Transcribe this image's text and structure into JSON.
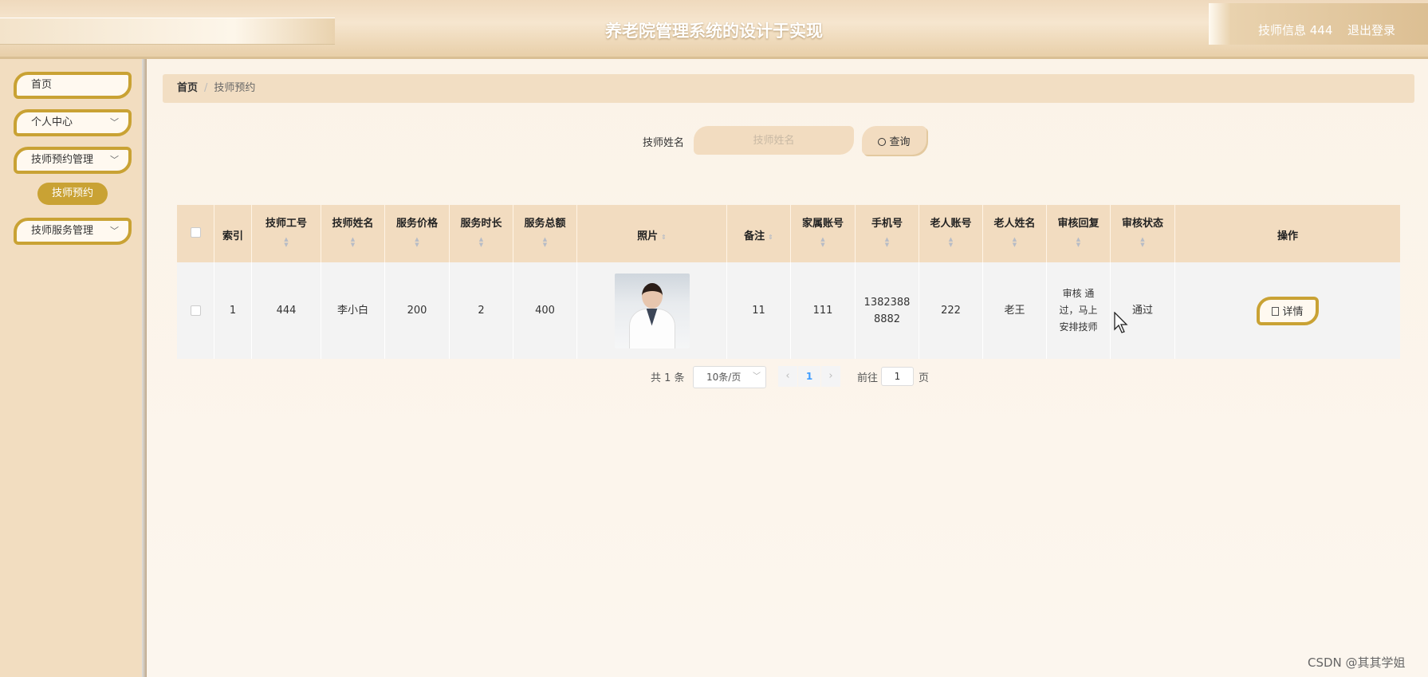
{
  "header": {
    "title": "养老院管理系统的设计于实现",
    "user_info": "技师信息 444",
    "logout": "退出登录"
  },
  "sidebar": {
    "items": [
      {
        "label": "首页"
      },
      {
        "label": "个人中心",
        "icon": "chevron-down-icon"
      },
      {
        "label": "技师预约管理",
        "icon": "chevron-down-icon"
      },
      {
        "label": "技师服务管理",
        "icon": "chevron-down-icon"
      }
    ],
    "subitem": "技师预约"
  },
  "breadcrumb": {
    "home": "首页",
    "separator": "/",
    "current": "技师预约"
  },
  "search": {
    "label": "技师姓名",
    "placeholder": "技师姓名",
    "button": "查询",
    "button_icon": "search-icon"
  },
  "table": {
    "headers": [
      "索引",
      "技师工号",
      "技师姓名",
      "服务价格",
      "服务时长",
      "服务总额",
      "照片",
      "备注",
      "家属账号",
      "手机号",
      "老人账号",
      "老人姓名",
      "审核回复",
      "审核状态",
      "操作"
    ],
    "rows": [
      {
        "index": "1",
        "tech_id": "444",
        "tech_name": "李小白",
        "price": "200",
        "duration": "2",
        "total": "400",
        "remark": "11",
        "family_account": "111",
        "phone_line1": "1382388",
        "phone_line2": "8882",
        "elder_account": "222",
        "elder_name": "老王",
        "reply_line1": "审核 通",
        "reply_line2": "过，马上",
        "reply_line3": "安排技师",
        "status": "通过",
        "action": "详情"
      }
    ]
  },
  "pagination": {
    "total": "共 1 条",
    "page_size": "10条/页",
    "current_page": "1",
    "goto_label": "前往",
    "goto_value": "1",
    "page_unit": "页"
  },
  "watermark": "CSDN @其其学姐",
  "colors": {
    "accent": "#c9a234",
    "panel": "#f2dcc0",
    "background": "#fbf4ea"
  }
}
